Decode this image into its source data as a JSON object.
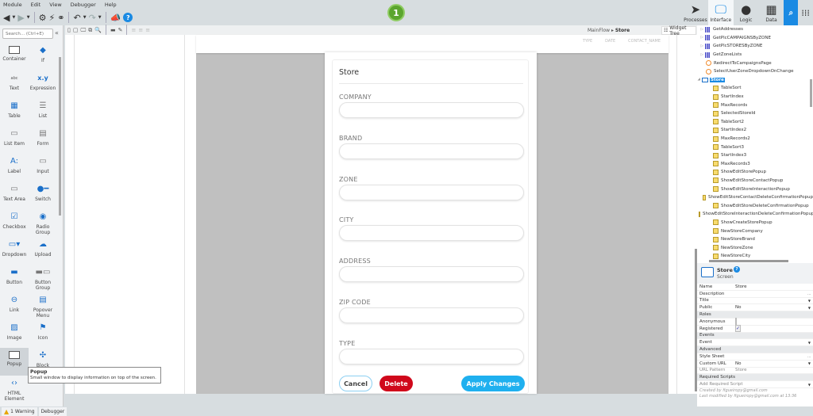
{
  "menu": [
    "Module",
    "Edit",
    "View",
    "Debugger",
    "Help"
  ],
  "toolbar": {
    "icons": [
      "back-icon",
      "forward-icon",
      "settings-icon",
      "publish-icon",
      "connect-icon",
      "undo-icon",
      "redo-icon",
      "announce-icon",
      "help-icon"
    ]
  },
  "badge": {
    "count": "1",
    "color": "#5ba52e"
  },
  "topnav": [
    {
      "label": "Processes",
      "icon": "processes-icon"
    },
    {
      "label": "Interface",
      "icon": "interface-icon",
      "active": true
    },
    {
      "label": "Logic",
      "icon": "logic-icon"
    },
    {
      "label": "Data",
      "icon": "data-icon"
    }
  ],
  "palette": {
    "search_placeholder": "Search... (Ctrl+E)",
    "items": [
      {
        "label": "Container",
        "icon": "container-icon"
      },
      {
        "label": "If",
        "icon": "if-icon"
      },
      {
        "label": "Text",
        "icon": "text-icon"
      },
      {
        "label": "Expression",
        "icon": "expression-icon"
      },
      {
        "label": "Table",
        "icon": "table-icon"
      },
      {
        "label": "List",
        "icon": "list-icon"
      },
      {
        "label": "List Item",
        "icon": "list-item-icon"
      },
      {
        "label": "Form",
        "icon": "form-icon"
      },
      {
        "label": "Label",
        "icon": "label-icon"
      },
      {
        "label": "Input",
        "icon": "input-icon"
      },
      {
        "label": "Text Area",
        "icon": "text-area-icon"
      },
      {
        "label": "Switch",
        "icon": "switch-icon"
      },
      {
        "label": "Checkbox",
        "icon": "checkbox-icon"
      },
      {
        "label": "Radio Group",
        "icon": "radio-group-icon"
      },
      {
        "label": "Dropdown",
        "icon": "dropdown-icon"
      },
      {
        "label": "Upload",
        "icon": "upload-icon"
      },
      {
        "label": "Button",
        "icon": "button-icon"
      },
      {
        "label": "Button Group",
        "icon": "button-group-icon"
      },
      {
        "label": "Link",
        "icon": "link-icon"
      },
      {
        "label": "Popover Menu",
        "icon": "popover-menu-icon"
      },
      {
        "label": "Image",
        "icon": "image-icon"
      },
      {
        "label": "Icon",
        "icon": "icon-icon"
      },
      {
        "label": "Popup",
        "icon": "popup-icon",
        "selected": true
      },
      {
        "label": "Block",
        "icon": "block-icon"
      },
      {
        "label": "HTML Element",
        "icon": "html-element-icon"
      }
    ],
    "tooltip": {
      "title": "Popup",
      "text": "Small window to display information on top of the screen."
    }
  },
  "canvas": {
    "breadcrumb_parent": "MainFlow",
    "breadcrumb_current": "Store",
    "widget_tree_label": "Widget Tree",
    "table_columns": [
      "TYPE",
      "DATE",
      "CONTACT_NAME"
    ]
  },
  "popup": {
    "title": "Store",
    "fields": [
      {
        "label": "COMPANY",
        "value": ""
      },
      {
        "label": "BRAND",
        "value": ""
      },
      {
        "label": "ZONE",
        "value": ""
      },
      {
        "label": "CITY",
        "value": ""
      },
      {
        "label": "ADDRESS",
        "value": ""
      },
      {
        "label": "ZIP CODE",
        "value": ""
      },
      {
        "label": "TYPE",
        "value": ""
      }
    ],
    "cancel_label": "Cancel",
    "delete_label": "Delete",
    "apply_label": "Apply Changes"
  },
  "tree": {
    "items": [
      {
        "label": "GetAddresses",
        "type": "aggregate"
      },
      {
        "label": "GetPlcCAMPAIGNSByZONE",
        "type": "aggregate"
      },
      {
        "label": "GetPlcSTORESByZONE",
        "type": "aggregate"
      },
      {
        "label": "GetZoneLists",
        "type": "aggregate"
      },
      {
        "label": "RedirectToCampaignsPage",
        "type": "action"
      },
      {
        "label": "SelectUserZoneDropdownOnChange",
        "type": "action"
      },
      {
        "label": "Store",
        "type": "screen",
        "selected": true
      },
      {
        "label": "TableSort",
        "type": "variable"
      },
      {
        "label": "StartIndex",
        "type": "variable"
      },
      {
        "label": "MaxRecords",
        "type": "variable"
      },
      {
        "label": "SelectedStoreId",
        "type": "variable"
      },
      {
        "label": "TableSort2",
        "type": "variable"
      },
      {
        "label": "StartIndex2",
        "type": "variable"
      },
      {
        "label": "MaxRecords2",
        "type": "variable"
      },
      {
        "label": "TableSort3",
        "type": "variable"
      },
      {
        "label": "StartIndex3",
        "type": "variable"
      },
      {
        "label": "MaxRecords3",
        "type": "variable"
      },
      {
        "label": "ShowEditStorePopup",
        "type": "variable"
      },
      {
        "label": "ShowEditStoreContactPopup",
        "type": "variable"
      },
      {
        "label": "ShowEditStoreInteractionPopup",
        "type": "variable"
      },
      {
        "label": "ShowEditStoreContactDeleteConfirmationPopup",
        "type": "variable"
      },
      {
        "label": "ShowEditStoreDeleteConfirmationPopup",
        "type": "variable"
      },
      {
        "label": "ShowEditStoreInteractionDeleteConfirmationPopup",
        "type": "variable"
      },
      {
        "label": "ShowCreateStorePopup",
        "type": "variable"
      },
      {
        "label": "NewStoreCompany",
        "type": "variable"
      },
      {
        "label": "NewStoreBrand",
        "type": "variable"
      },
      {
        "label": "NewStoreZone",
        "type": "variable"
      },
      {
        "label": "NewStoreCity",
        "type": "variable"
      }
    ]
  },
  "properties": {
    "name": "Store",
    "type": "Screen",
    "rows": [
      {
        "key": "Name",
        "value": "Store"
      },
      {
        "key": "Description",
        "value": "",
        "extra": "..."
      },
      {
        "key": "Title",
        "value": "",
        "dropdown": true
      },
      {
        "key": "Public",
        "value": "No",
        "dropdown": true
      },
      {
        "section": "Roles"
      },
      {
        "key": "Anonymous",
        "checkbox": false
      },
      {
        "key": "Registered",
        "checkbox": true
      },
      {
        "section": "Events"
      },
      {
        "key": "Event",
        "value": "",
        "dropdown": true
      },
      {
        "section": "Advanced"
      },
      {
        "key": "Style Sheet",
        "value": "",
        "extra": "..."
      },
      {
        "key": "Custom URL",
        "value": "No",
        "dropdown": true
      },
      {
        "key": "URL Pattern",
        "value": "Store",
        "disabled": true
      },
      {
        "section": "Required Scripts"
      }
    ],
    "add_script_placeholder": "Add Required Script",
    "created_by": "Created by figueiropy@gmail.com",
    "modified_by": "Last modified by figueiropy@gmail.com at 13:36"
  },
  "status": {
    "warning_label": "1 Warning",
    "debugger_label": "Debugger"
  }
}
